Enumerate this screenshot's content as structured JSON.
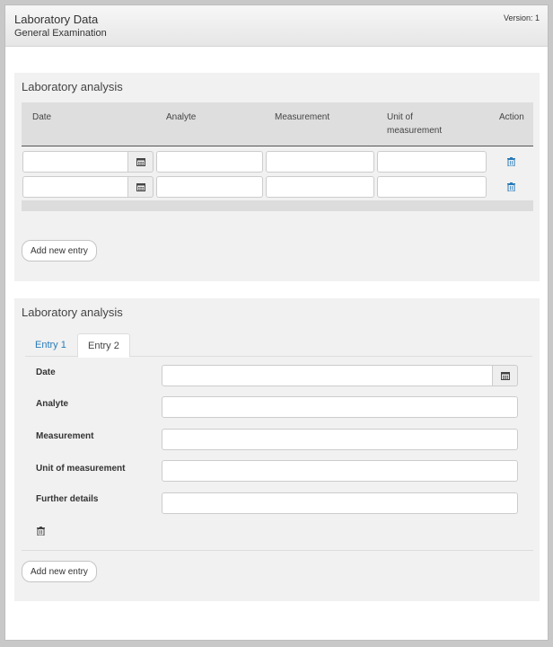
{
  "header": {
    "title": "Laboratory Data",
    "subtitle": "General Examination",
    "version": "Version: 1"
  },
  "panel1": {
    "title": "Laboratory analysis",
    "columns": [
      "Date",
      "Analyte",
      "Measurement",
      "Unit of measurement",
      "Action"
    ],
    "rows": [
      {
        "date": "",
        "analyte": "",
        "measurement": "",
        "unit": ""
      },
      {
        "date": "",
        "analyte": "",
        "measurement": "",
        "unit": ""
      }
    ],
    "add_button": "Add new entry"
  },
  "panel2": {
    "title": "Laboratory analysis",
    "tabs": [
      {
        "label": "Entry 1",
        "active": false
      },
      {
        "label": "Entry 2",
        "active": true
      }
    ],
    "fields": {
      "date": "Date",
      "analyte": "Analyte",
      "measurement": "Measurement",
      "unit": "Unit of measurement",
      "details": "Further details"
    },
    "add_button": "Add new entry"
  },
  "icons": {
    "calendar": "calendar-icon",
    "trash": "trash-icon"
  },
  "colors": {
    "link_blue": "#2a7bb8",
    "panel_bg": "#f1f1f1"
  }
}
